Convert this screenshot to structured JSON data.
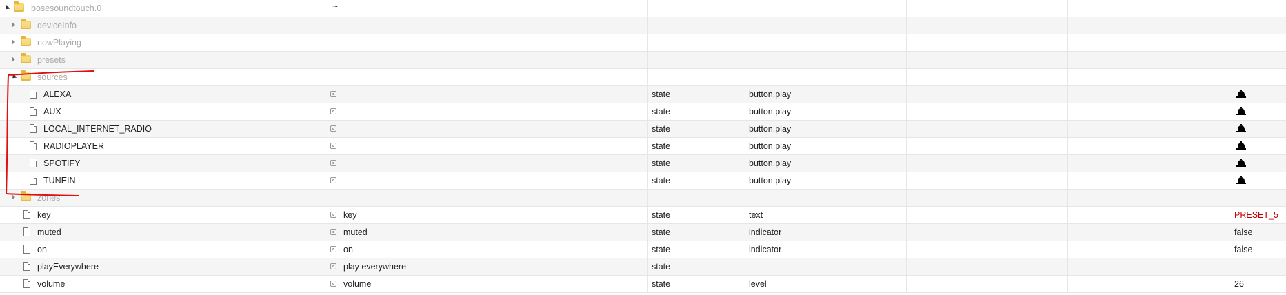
{
  "root": {
    "label": "bosesoundtouch.0",
    "name_col": "~"
  },
  "folders_top": [
    {
      "label": "deviceInfo"
    },
    {
      "label": "nowPlaying"
    },
    {
      "label": "presets"
    }
  ],
  "sources_folder": {
    "label": "sources"
  },
  "sources": [
    {
      "label": "ALEXA",
      "type": "state",
      "role": "button.play"
    },
    {
      "label": "AUX",
      "type": "state",
      "role": "button.play"
    },
    {
      "label": "LOCAL_INTERNET_RADIO",
      "type": "state",
      "role": "button.play"
    },
    {
      "label": "RADIOPLAYER",
      "type": "state",
      "role": "button.play"
    },
    {
      "label": "SPOTIFY",
      "type": "state",
      "role": "button.play"
    },
    {
      "label": "TUNEIN",
      "type": "state",
      "role": "button.play"
    }
  ],
  "zones_folder": {
    "label": "zones"
  },
  "states": [
    {
      "label": "key",
      "name": "key",
      "type": "state",
      "role": "text",
      "value": "PRESET_5"
    },
    {
      "label": "muted",
      "name": "muted",
      "type": "state",
      "role": "indicator",
      "value": "false"
    },
    {
      "label": "on",
      "name": "on",
      "type": "state",
      "role": "indicator",
      "value": "false"
    },
    {
      "label": "playEverywhere",
      "name": "play everywhere",
      "type": "state",
      "role": "",
      "value": ""
    },
    {
      "label": "volume",
      "name": "volume",
      "type": "state",
      "role": "level",
      "value": "26"
    }
  ],
  "colors": {
    "annotation": "#e01010",
    "value_highlight": "#c00000"
  },
  "icons": {
    "folder": "folder-icon",
    "file": "file-icon",
    "role": "role-icon",
    "button": "bell-button-icon"
  }
}
